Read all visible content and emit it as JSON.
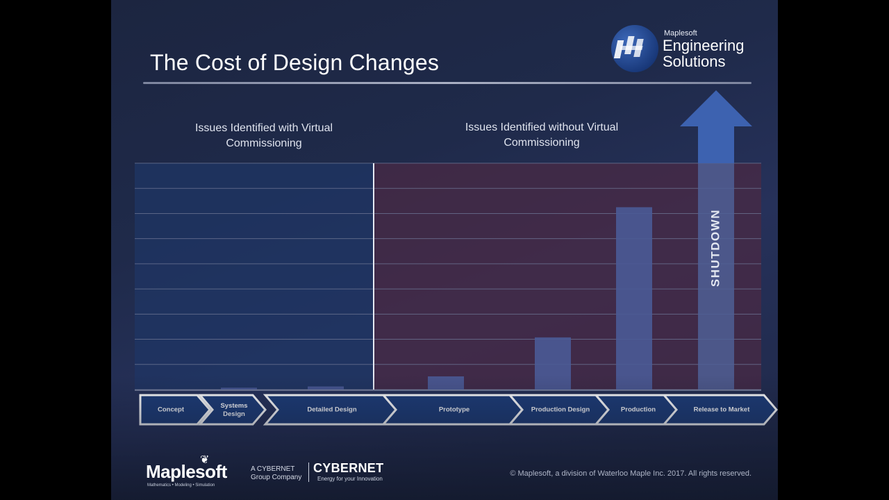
{
  "title": "The Cost of Design Changes",
  "logo": {
    "small": "Maplesoft",
    "line1": "Engineering",
    "line2": "Solutions"
  },
  "sections": {
    "left": "Issues Identified with Virtual Commissioning",
    "right": "Issues Identified without Virtual Commissioning"
  },
  "chart_data": {
    "type": "bar",
    "categories": [
      "Concept",
      "Systems Design",
      "Detailed Design",
      "Prototype",
      "Production Design",
      "Production",
      "Release to Market"
    ],
    "values": [
      0,
      0.3,
      0.5,
      2.1,
      8.3,
      29.0,
      90
    ],
    "ylim": [
      0,
      36
    ],
    "grid": true,
    "annotations": [
      "SHUTDOWN"
    ],
    "colors": {
      "left_region": "#1f3564",
      "right_region": "#4a2a44",
      "bars": "#4a5a96",
      "arrow": "#3d62b0",
      "arrow_shaft": "#4f5f95"
    }
  },
  "footer": {
    "maplesoft": "Maplesoft",
    "maplesoft_sub": "Mathematics • Modeling • Simulation",
    "cybernet_small": "A CYBERNET Group Company",
    "cybernet": "CYBERNET",
    "cybernet_tag": "Energy for your Innovation",
    "copyright": "© Maplesoft, a division of Waterloo Maple Inc. 2017. All rights reserved."
  }
}
